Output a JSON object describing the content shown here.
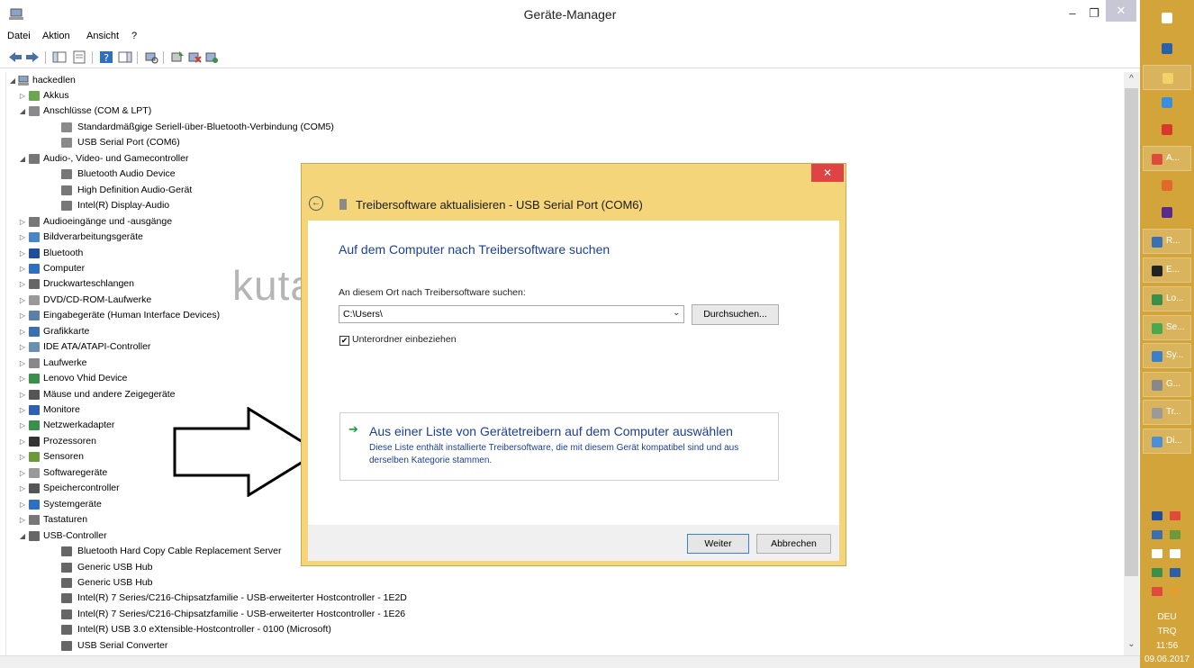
{
  "window": {
    "title": "Geräte-Manager",
    "minimize_glyph": "–",
    "maximize_glyph": "❐",
    "close_glyph": "✕"
  },
  "menu": [
    "Datei",
    "Aktion",
    "Ansicht",
    "?"
  ],
  "tree": {
    "root": "hackedlen",
    "items": [
      {
        "label": "Akkus",
        "level": 1,
        "expand": "▷",
        "icon_color": "#6aa84f"
      },
      {
        "label": "Anschlüsse (COM & LPT)",
        "level": 1,
        "expand": "◢",
        "icon_color": "#8a8a8a"
      },
      {
        "label": "Standardmäßgige Seriell-über-Bluetooth-Verbindung (COM5)",
        "level": 2,
        "expand": "",
        "icon_color": "#8a8a8a"
      },
      {
        "label": "USB Serial Port (COM6)",
        "level": 2,
        "expand": "",
        "icon_color": "#8a8a8a"
      },
      {
        "label": "Audio-, Video- und Gamecontroller",
        "level": 1,
        "expand": "◢",
        "icon_color": "#777777"
      },
      {
        "label": "Bluetooth Audio Device",
        "level": 2,
        "expand": "",
        "icon_color": "#777777"
      },
      {
        "label": "High Definition Audio-Gerät",
        "level": 2,
        "expand": "",
        "icon_color": "#777777"
      },
      {
        "label": "Intel(R) Display-Audio",
        "level": 2,
        "expand": "",
        "icon_color": "#777777"
      },
      {
        "label": "Audioeingänge und -ausgänge",
        "level": 1,
        "expand": "▷",
        "icon_color": "#777777"
      },
      {
        "label": "Bildverarbeitungsgeräte",
        "level": 1,
        "expand": "▷",
        "icon_color": "#4a86c6"
      },
      {
        "label": "Bluetooth",
        "level": 1,
        "expand": "▷",
        "icon_color": "#1f4e9c"
      },
      {
        "label": "Computer",
        "level": 1,
        "expand": "▷",
        "icon_color": "#2f6fc0"
      },
      {
        "label": "Druckwarteschlangen",
        "level": 1,
        "expand": "▷",
        "icon_color": "#666666"
      },
      {
        "label": "DVD/CD-ROM-Laufwerke",
        "level": 1,
        "expand": "▷",
        "icon_color": "#999999"
      },
      {
        "label": "Eingabegeräte (Human Interface Devices)",
        "level": 1,
        "expand": "▷",
        "icon_color": "#5a7fa8"
      },
      {
        "label": "Grafikkarte",
        "level": 1,
        "expand": "▷",
        "icon_color": "#3a6fb0"
      },
      {
        "label": "IDE ATA/ATAPI-Controller",
        "level": 1,
        "expand": "▷",
        "icon_color": "#6a8faf"
      },
      {
        "label": "Laufwerke",
        "level": 1,
        "expand": "▷",
        "icon_color": "#888888"
      },
      {
        "label": "Lenovo Vhid Device",
        "level": 1,
        "expand": "▷",
        "icon_color": "#3a8f4a"
      },
      {
        "label": "Mäuse und andere Zeigegeräte",
        "level": 1,
        "expand": "▷",
        "icon_color": "#555555"
      },
      {
        "label": "Monitore",
        "level": 1,
        "expand": "▷",
        "icon_color": "#2f5fb0"
      },
      {
        "label": "Netzwerkadapter",
        "level": 1,
        "expand": "▷",
        "icon_color": "#3a8f4a"
      },
      {
        "label": "Prozessoren",
        "level": 1,
        "expand": "▷",
        "icon_color": "#333333"
      },
      {
        "label": "Sensoren",
        "level": 1,
        "expand": "▷",
        "icon_color": "#6a9a3a"
      },
      {
        "label": "Softwaregeräte",
        "level": 1,
        "expand": "▷",
        "icon_color": "#999999"
      },
      {
        "label": "Speichercontroller",
        "level": 1,
        "expand": "▷",
        "icon_color": "#555555"
      },
      {
        "label": "Systemgeräte",
        "level": 1,
        "expand": "▷",
        "icon_color": "#2f6fc0"
      },
      {
        "label": "Tastaturen",
        "level": 1,
        "expand": "▷",
        "icon_color": "#777777"
      },
      {
        "label": "USB-Controller",
        "level": 1,
        "expand": "◢",
        "icon_color": "#666666"
      },
      {
        "label": "Bluetooth Hard Copy Cable Replacement Server",
        "level": 2,
        "expand": "",
        "icon_color": "#666666"
      },
      {
        "label": "Generic USB Hub",
        "level": 2,
        "expand": "",
        "icon_color": "#666666"
      },
      {
        "label": "Generic USB Hub",
        "level": 2,
        "expand": "",
        "icon_color": "#666666"
      },
      {
        "label": "Intel(R) 7 Series/C216-Chipsatzfamilie - USB-erweiterter Hostcontroller - 1E2D",
        "level": 2,
        "expand": "",
        "icon_color": "#666666"
      },
      {
        "label": "Intel(R) 7 Series/C216-Chipsatzfamilie - USB-erweiterter Hostcontroller - 1E26",
        "level": 2,
        "expand": "",
        "icon_color": "#666666"
      },
      {
        "label": "Intel(R) USB 3.0 eXtensible-Hostcontroller - 0100 (Microsoft)",
        "level": 2,
        "expand": "",
        "icon_color": "#666666"
      },
      {
        "label": "USB Serial Converter",
        "level": 2,
        "expand": "",
        "icon_color": "#666666"
      }
    ]
  },
  "scroll": {
    "up": "^",
    "down": "⌄"
  },
  "watermark": "kutayzorlu.com",
  "dialog": {
    "close_glyph": "✕",
    "back_glyph": "←",
    "title": "Treibersoftware aktualisieren - USB Serial Port (COM6)",
    "heading": "Auf dem Computer nach Treibersoftware suchen",
    "search_label": "An diesem Ort nach Treibersoftware suchen:",
    "path_value": "C:\\Users\\",
    "dropdown_glyph": "⌄",
    "browse_label": "Durchsuchen...",
    "subfolder_checked": "✔",
    "subfolder_label": "Unterordner einbeziehen",
    "choose_arrow": "➔",
    "choose_title": "Aus einer Liste von Gerätetreibern auf dem Computer auswählen",
    "choose_desc": "Diese Liste enthält installierte Treibersoftware, die mit diesem Gerät kompatibel sind und aus derselben Kategorie stammen.",
    "next_label": "Weiter",
    "cancel_label": "Abbrechen"
  },
  "taskbar": {
    "background": "#d2a43a",
    "buttons": [
      {
        "label": "",
        "icon_color": "#ffffff",
        "active": false
      },
      {
        "label": "",
        "icon_color": "#2b5fa8",
        "active": false
      },
      {
        "label": "",
        "icon_color": "#f2d36a",
        "active": true
      },
      {
        "label": "",
        "icon_color": "#3a8fd8",
        "active": false
      },
      {
        "label": "",
        "icon_color": "#d83a2a",
        "active": false
      },
      {
        "label": "A...",
        "icon_color": "#e04a3a",
        "active": true
      },
      {
        "label": "",
        "icon_color": "#e06a2a",
        "active": false
      },
      {
        "label": "",
        "icon_color": "#5a2a8a",
        "active": false
      },
      {
        "label": "R...",
        "icon_color": "#3a6fb0",
        "active": true
      },
      {
        "label": "E...",
        "icon_color": "#222222",
        "active": true
      },
      {
        "label": "Lo...",
        "icon_color": "#3a8f4a",
        "active": true
      },
      {
        "label": "Se...",
        "icon_color": "#4aa84f",
        "active": true
      },
      {
        "label": "Sy...",
        "icon_color": "#3a7fc8",
        "active": true
      },
      {
        "label": "G...",
        "icon_color": "#888888",
        "active": true
      },
      {
        "label": "Tr...",
        "icon_color": "#9a9a9a",
        "active": true
      },
      {
        "label": "Di...",
        "icon_color": "#4a8fd8",
        "active": true
      }
    ],
    "tray_colors": [
      "#1f4e9c",
      "#e04a3a",
      "#3a6fb0",
      "#6a9a3a",
      "#ffffff",
      "#ffffff",
      "#3a8f4a",
      "#2b5fa8",
      "#e04a3a",
      "#e0a030"
    ],
    "language": "DEU",
    "layout": "TRQ",
    "time": "11:56",
    "date": "09.06.2017"
  }
}
